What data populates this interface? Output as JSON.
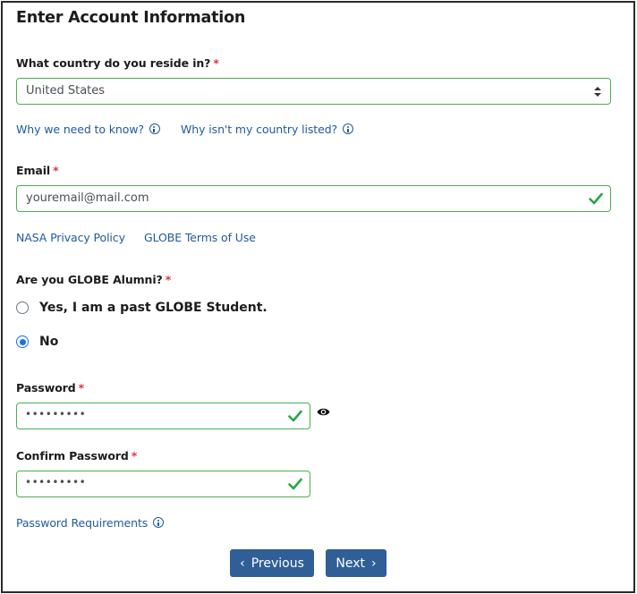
{
  "form": {
    "title": "Enter Account Information",
    "required_marker": "*",
    "country": {
      "label": "What country do you reside in?",
      "selected": "United States",
      "links": [
        {
          "label": "Why we need to know?",
          "icon": "info-icon"
        },
        {
          "label": "Why isn't my country listed?",
          "icon": "info-icon"
        }
      ]
    },
    "email": {
      "label": "Email",
      "value": "youremail@mail.com",
      "valid_icon": "checkmark-icon",
      "links": [
        {
          "label": "NASA Privacy Policy"
        },
        {
          "label": "GLOBE Terms of Use"
        }
      ]
    },
    "alumni": {
      "label": "Are you GLOBE Alumni?",
      "options": [
        {
          "label": "Yes, I am a past GLOBE Student.",
          "selected": false
        },
        {
          "label": "No",
          "selected": true
        }
      ]
    },
    "password": {
      "label": "Password",
      "value_masked": "•••••••••",
      "valid_icon": "checkmark-icon",
      "toggle_icon": "eye-icon"
    },
    "confirm_password": {
      "label": "Confirm Password",
      "value_masked": "•••••••••",
      "valid_icon": "checkmark-icon"
    },
    "password_requirements_link": "Password Requirements",
    "buttons": {
      "previous": "Previous",
      "next": "Next",
      "previous_chevron": "‹",
      "next_chevron": "›"
    }
  },
  "colors": {
    "valid_border": "#4caf50",
    "link": "#1f5a9d",
    "required": "#dc3545",
    "button": "#2f5f96",
    "radio_selected": "#1a73e8"
  }
}
